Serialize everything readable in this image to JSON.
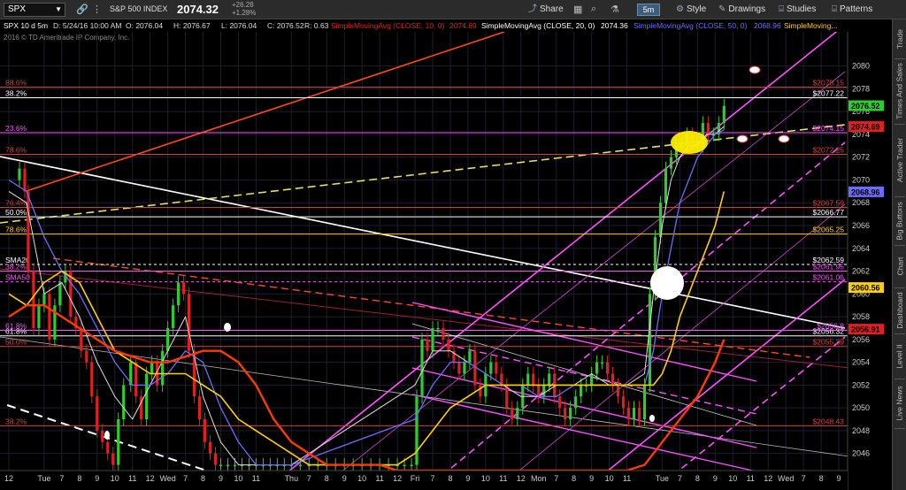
{
  "toolbar": {
    "symbol": "SPX",
    "name": "S&P 500 INDEX",
    "last": "2074.32",
    "change": "+26.28",
    "change_pct": "+1.28%",
    "share": "Share",
    "timeframe": "5m",
    "style": "Style",
    "drawings": "Drawings",
    "studies": "Studies",
    "patterns": "Patterns"
  },
  "info": {
    "chart_id": "SPX 10 d 5m",
    "datetime": "D: 5/24/16 10:00 AM",
    "open": "O: 2076.04",
    "high": "H: 2076.67",
    "low": "L: 2076.04",
    "close": "C: 2076.52",
    "range": "R: 0.63",
    "sma10": "SimpleMovingAvg (CLOSE, 10, 0)",
    "sma10_val": "2074.69",
    "sma20": "SimpleMovingAvg (CLOSE, 20, 0)",
    "sma20_val": "2074.36",
    "sma50": "SimpleMovingAvg (CLOSE, 50, 0)",
    "sma50_val": "2068.96",
    "sma_more": "SimpleMoving...",
    "copyright": "2016 © TD Ameritrade IP Company, Inc."
  },
  "colors": {
    "up": "#2ecc2e",
    "down": "#e02020",
    "sma10": "#e0e0e0",
    "sma20": "#6b6bff",
    "sma50": "#ffd000",
    "ema": "#ff3a00",
    "channel": "#ff4fff",
    "grid": "#1e1e2e"
  },
  "chart_data": {
    "type": "line",
    "title": "",
    "ylim": [
      2044.5,
      2083
    ],
    "y_ticks": [
      2046,
      2048,
      2050,
      2052,
      2054,
      2056,
      2058,
      2060,
      2062,
      2064,
      2066,
      2068,
      2070,
      2072,
      2074,
      2076,
      2078,
      2080
    ],
    "x_ticks": [
      "12",
      "Tue",
      "7",
      "8",
      "9",
      "10",
      "11",
      "12",
      "Wed",
      "7",
      "8",
      "9",
      "10",
      "11",
      "Thu",
      "7",
      "8",
      "9",
      "10",
      "11",
      "12",
      "Fri",
      "7",
      "8",
      "9",
      "10",
      "11",
      "12",
      "Mon",
      "7",
      "8",
      "9",
      "10",
      "11",
      "Tue",
      "7",
      "8",
      "9",
      "10",
      "11",
      "12",
      "Wed",
      "7",
      "8",
      "9"
    ],
    "x_tick_index": [
      0,
      2,
      3,
      4,
      5,
      6,
      7,
      8,
      9,
      10,
      11,
      12,
      13,
      14,
      16,
      17,
      18,
      19,
      20,
      21,
      22,
      23,
      24,
      25,
      26,
      27,
      28,
      29,
      30,
      31,
      32,
      33,
      34,
      35,
      37,
      38,
      39,
      40,
      41,
      42,
      43,
      44,
      45,
      46,
      47
    ],
    "x_count": 48,
    "series": [
      {
        "key": "price",
        "x": [
          0.3,
          0.6,
          0.9,
          1.1,
          1.4,
          1.7,
          2.0,
          2.3,
          2.6,
          2.9,
          3.2,
          3.5,
          3.8,
          4.1,
          4.4,
          4.7,
          5.0,
          5.3,
          5.6,
          5.9,
          6.2,
          6.5,
          6.9,
          7.2,
          7.5,
          7.8,
          8.1,
          8.4,
          8.7,
          9.0,
          9.3,
          9.6,
          9.9,
          10.2,
          10.5,
          10.8,
          11.1,
          11.4,
          11.7,
          12.0,
          12.4,
          12.8,
          13.2,
          13.6,
          14.0,
          14.4,
          14.8,
          15.2,
          15.6,
          16.0,
          16.5,
          17.0,
          17.5,
          18.0,
          18.5,
          19.0,
          19.5,
          20.0,
          20.5,
          21.0,
          21.5,
          22.0,
          22.4,
          22.8,
          23.1,
          23.4,
          23.7,
          24.0,
          24.3,
          24.6,
          24.9,
          25.2,
          25.5,
          25.8,
          26.1,
          26.4,
          26.7,
          27.0,
          27.3,
          27.6,
          27.9,
          28.2,
          28.5,
          28.8,
          29.1,
          29.4,
          29.7,
          30.0,
          30.3,
          30.6,
          30.9,
          31.2,
          31.5,
          31.8,
          32.1,
          32.4,
          32.7,
          33.0,
          33.3,
          33.6,
          33.9,
          34.2,
          34.5,
          34.8,
          35.1,
          35.4,
          35.7,
          36.0,
          36.3,
          36.6,
          36.9,
          37.2,
          37.5,
          37.8,
          38.1,
          38.4,
          38.7,
          39.0,
          39.3,
          39.6,
          39.9,
          40.2,
          40.5
        ],
        "values": [
          2070,
          2071,
          2069,
          2062,
          2057,
          2059,
          2060,
          2056,
          2059,
          2061,
          2062,
          2058,
          2057,
          2055,
          2054,
          2051,
          2048,
          2047,
          2046,
          2045,
          2049,
          2052,
          2054,
          2051,
          2049,
          2053,
          2054,
          2052,
          2055,
          2057,
          2059,
          2061,
          2060,
          2055,
          2051,
          2049,
          2047,
          2046,
          2045,
          2045,
          2045,
          2045,
          2045,
          2045,
          2045,
          2045,
          2045,
          2045,
          2045,
          2045,
          2045,
          2045,
          2045,
          2045,
          2045,
          2045,
          2045,
          2045,
          2045,
          2045,
          2045,
          2045,
          2045,
          2045,
          2051,
          2056,
          2055,
          2057,
          2057,
          2056,
          2055,
          2054,
          2053,
          2054,
          2055,
          2052,
          2051,
          2053,
          2054,
          2053,
          2052,
          2050,
          2049,
          2050,
          2052,
          2053,
          2052,
          2051,
          2052,
          2053,
          2051,
          2050,
          2049,
          2050,
          2051,
          2052,
          2052,
          2053,
          2054,
          2054,
          2053,
          2052,
          2051,
          2050,
          2049,
          2050,
          2049,
          2052,
          2060,
          2065,
          2068,
          2071,
          2072,
          2073,
          2073,
          2074,
          2073,
          2073,
          2075,
          2074,
          2074,
          2075,
          2076.5
        ]
      },
      {
        "key": "sma10",
        "x": [
          0,
          1,
          2,
          3,
          4,
          5,
          6,
          7,
          8,
          9,
          10,
          11,
          12,
          13,
          14,
          16,
          23,
          24,
          25,
          26,
          27,
          28,
          29,
          30,
          31,
          32,
          33,
          34,
          35,
          36,
          36.5,
          37,
          37.5,
          38,
          38.5,
          39,
          39.5,
          40,
          40.5
        ],
        "values": [
          2069,
          2068,
          2060,
          2061,
          2058,
          2054,
          2051,
          2049,
          2052,
          2055,
          2058,
          2051,
          2047,
          2045,
          2045,
          2045,
          2052,
          2055,
          2055,
          2054,
          2053,
          2052,
          2051,
          2051,
          2052,
          2052,
          2053,
          2052,
          2052,
          2053,
          2060,
          2066,
          2070,
          2072,
          2073,
          2073,
          2074,
          2074,
          2074.7
        ]
      },
      {
        "key": "sma20",
        "x": [
          0,
          1,
          2,
          3,
          4,
          5,
          6,
          7,
          8,
          9,
          10,
          11,
          12,
          13,
          14,
          16,
          23,
          24,
          25,
          26,
          27,
          28,
          29,
          30,
          31,
          32,
          33,
          34,
          35,
          36,
          36.5,
          37,
          37.5,
          38,
          38.5,
          39,
          39.5,
          40,
          40.5
        ],
        "values": [
          2070,
          2069,
          2065,
          2062,
          2060,
          2057,
          2054,
          2052,
          2052,
          2053,
          2055,
          2054,
          2050,
          2047,
          2045,
          2045,
          2049,
          2052,
          2054,
          2054,
          2053,
          2052,
          2052,
          2051,
          2051,
          2052,
          2052,
          2052,
          2052,
          2052,
          2055,
          2060,
          2064,
          2068,
          2070,
          2072,
          2073,
          2074,
          2074.4
        ]
      },
      {
        "key": "sma50",
        "x": [
          0,
          1,
          2,
          3,
          4,
          5,
          6,
          7,
          8,
          9,
          10,
          11,
          12,
          13,
          14,
          16,
          17,
          18,
          19,
          20,
          21,
          22,
          23,
          24,
          25,
          26,
          27,
          28,
          29,
          30,
          31,
          32,
          33,
          34,
          35,
          36,
          36.5,
          37,
          37.5,
          38,
          38.5,
          39,
          39.5,
          40,
          40.5
        ],
        "values": [
          2060,
          2059,
          2061,
          2062,
          2061,
          2058,
          2055,
          2054,
          2053,
          2053,
          2053,
          2052,
          2051,
          2049,
          2048,
          2046,
          2045,
          2045,
          2045,
          2045,
          2045,
          2045,
          2046,
          2048,
          2050,
          2051,
          2052,
          2052,
          2052,
          2052,
          2052,
          2052,
          2052,
          2052,
          2052,
          2052,
          2052,
          2053,
          2055,
          2058,
          2060,
          2062,
          2064,
          2066,
          2069
        ]
      },
      {
        "key": "ema",
        "x": [
          0,
          1,
          2,
          3,
          4,
          5,
          6,
          7,
          8,
          9,
          10,
          11,
          12,
          13,
          14,
          15,
          16,
          17,
          18,
          19,
          20,
          21,
          22,
          23,
          24,
          25,
          26,
          27,
          28,
          29,
          30,
          31,
          32,
          33,
          34,
          35,
          36,
          37,
          38,
          39,
          40,
          40.5
        ],
        "values": [
          2058,
          2059,
          2059,
          2058,
          2057,
          2056,
          2055,
          2054.5,
          2054,
          2054,
          2054.5,
          2055,
          2055,
          2054,
          2052,
          2049,
          2047,
          2046,
          2045,
          2045,
          2045,
          2045,
          2044.5,
          2044.5,
          2044.5,
          2044.5,
          2044.5,
          2044.5,
          2044.5,
          2044.5,
          2044.5,
          2044.5,
          2044.5,
          2044.5,
          2044.5,
          2044.5,
          2045,
          2047,
          2049,
          2051,
          2054,
          2056
        ]
      }
    ],
    "hlines": [
      {
        "y": 2078.15,
        "left": "88.6%",
        "right": "$2078.15",
        "color": "#d04040"
      },
      {
        "y": 2077.22,
        "left": "38.2%",
        "right": "$2077.22",
        "color": "#ffffff"
      },
      {
        "y": 2074.15,
        "left": "23.6%",
        "right": "$2074.15",
        "color": "#ff4fff"
      },
      {
        "y": 2072.25,
        "left": "78.6%",
        "right": "$2072.25",
        "color": "#d04040"
      },
      {
        "y": 2067.59,
        "left": "76.4%",
        "right": "$2067.59",
        "color": "#d04040"
      },
      {
        "y": 2066.77,
        "left": "50.0%",
        "right": "$2066.77",
        "color": "#ffffff"
      },
      {
        "y": 2065.25,
        "left": "78.6%",
        "right": "$2065.25",
        "color": "#ffd000"
      },
      {
        "y": 2062.59,
        "left": "SMA20",
        "right": "$2062.59",
        "color": "#ffffff",
        "dash": true
      },
      {
        "y": 2062.0,
        "left": "38.2%",
        "right": "$2061.95",
        "color": "#ff4fff"
      },
      {
        "y": 2061.06,
        "left": "SMA50",
        "right": "$2061.06",
        "color": "#ff4fff",
        "dash": true
      },
      {
        "y": 2056.32,
        "left": "61.8%",
        "right": "$2056.32",
        "color": "#ffffff"
      },
      {
        "y": 2056.8,
        "left": "61.8%",
        "right": "$2056.8",
        "color": "#ff4fff"
      },
      {
        "y": 2055.39,
        "left": "50.0%",
        "right": "$2055.39",
        "color": "#d04040"
      },
      {
        "y": 2048.43,
        "left": "38.2%",
        "right": "$2048.43",
        "color": "#d04040"
      }
    ],
    "price_tags": [
      {
        "y": 2076.52,
        "label": "2076.52",
        "color": "#2ecc2e"
      },
      {
        "y": 2074.69,
        "label": "2074.69",
        "color": "#e02020"
      },
      {
        "y": 2068.96,
        "label": "2068.96",
        "color": "#6b6bff"
      },
      {
        "y": 2060.56,
        "label": "2060.56",
        "color": "#ffd000"
      },
      {
        "y": 2056.91,
        "label": "2056.91",
        "color": "#e02020"
      }
    ]
  },
  "sidebar": {
    "tabs": [
      "Trade",
      "Times And Sales",
      "Active Trader",
      "Big Buttons",
      "Chart",
      "Dashboard",
      "Level II",
      "Live News"
    ]
  }
}
